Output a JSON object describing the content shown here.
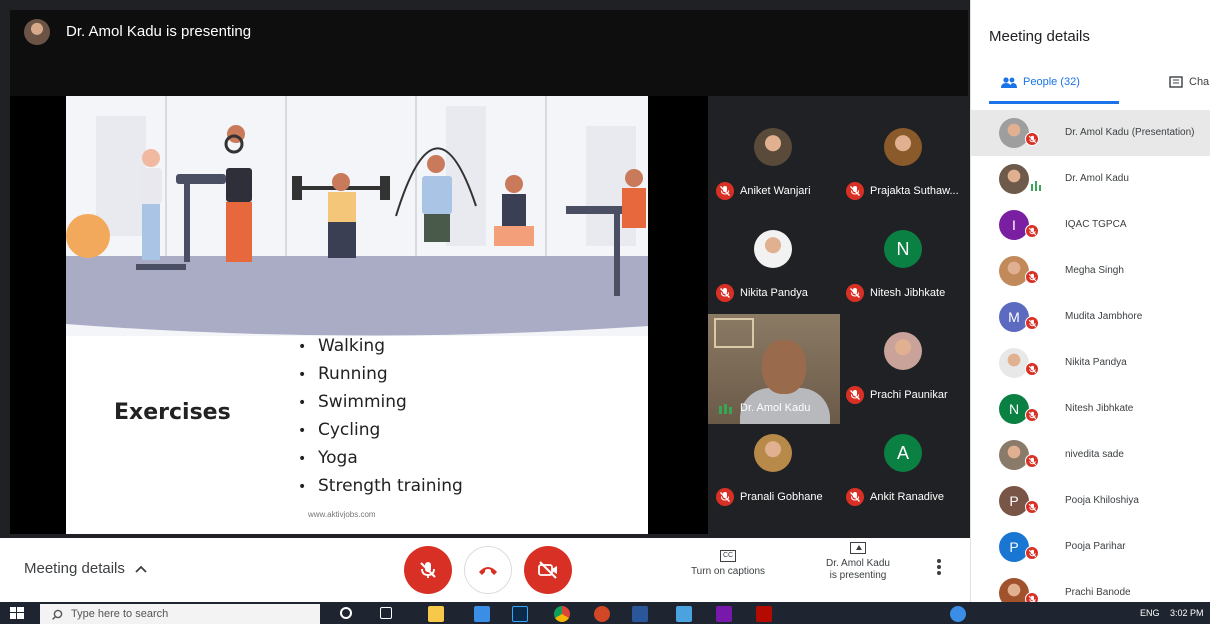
{
  "presenter_bar": {
    "text": "Dr. Amol Kadu is presenting"
  },
  "slide": {
    "title": "Exercises",
    "bullets": [
      "Walking",
      "Running",
      "Swimming",
      "Cycling",
      "Yoga",
      "Strength training"
    ],
    "watermark": "www.aktivjobs.com"
  },
  "tiles": [
    {
      "name": "Aniket Wanjari",
      "avatar_type": "photo",
      "avatar_color": "#5a4a3a"
    },
    {
      "name": "Prajakta Suthaw...",
      "avatar_type": "photo",
      "avatar_color": "#8a5a2a"
    },
    {
      "name": "Nikita Pandya",
      "avatar_type": "photo",
      "avatar_color": "#f2f2f2"
    },
    {
      "name": "Nitesh Jibhkate",
      "avatar_type": "letter",
      "letter": "N",
      "avatar_color": "#0b8043"
    },
    {
      "name": "Prachi Paunikar",
      "avatar_type": "photo",
      "avatar_color": "#c9a29a"
    },
    {
      "name": "Pranali Gobhane",
      "avatar_type": "photo",
      "avatar_color": "#b88a4a"
    },
    {
      "name": "Ankit Ranadive",
      "avatar_type": "letter",
      "letter": "A",
      "avatar_color": "#0b8043"
    }
  ],
  "video_tile": {
    "name": "Dr. Amol Kadu"
  },
  "controls": {
    "meeting_details": "Meeting details",
    "captions": "Turn on captions",
    "present_line1": "Dr. Amol Kadu",
    "present_line2": "is presenting",
    "cc_label": "CC"
  },
  "panel": {
    "title": "Meeting details",
    "tab_people": "People (32)",
    "tab_chat": "Cha",
    "people": [
      {
        "name": "Dr. Amol Kadu (Presentation)",
        "avatar_type": "photo",
        "avatar_color": "#9e9e9e",
        "muted": true,
        "highlight": true
      },
      {
        "name": "Dr. Amol Kadu",
        "avatar_type": "photo",
        "avatar_color": "#6d5a4a",
        "muted": false,
        "speaking": true
      },
      {
        "name": "IQAC TGPCA",
        "avatar_type": "letter",
        "letter": "I",
        "avatar_color": "#7b1fa2",
        "muted": true
      },
      {
        "name": "Megha Singh",
        "avatar_type": "photo",
        "avatar_color": "#c28a5a",
        "muted": true
      },
      {
        "name": "Mudita Jambhore",
        "avatar_type": "letter",
        "letter": "M",
        "avatar_color": "#5c6bc0",
        "muted": true
      },
      {
        "name": "Nikita Pandya",
        "avatar_type": "photo",
        "avatar_color": "#e8e8e8",
        "muted": true
      },
      {
        "name": "Nitesh Jibhkate",
        "avatar_type": "letter",
        "letter": "N",
        "avatar_color": "#0b8043",
        "muted": true
      },
      {
        "name": "nivedita sade",
        "avatar_type": "photo",
        "avatar_color": "#8a7a6a",
        "muted": true
      },
      {
        "name": "Pooja Khiloshiya",
        "avatar_type": "letter",
        "letter": "P",
        "avatar_color": "#795548",
        "muted": true
      },
      {
        "name": "Pooja Parihar",
        "avatar_type": "letter",
        "letter": "P",
        "avatar_color": "#1976d2",
        "muted": true
      },
      {
        "name": "Prachi Banode",
        "avatar_type": "photo",
        "avatar_color": "#a0522d",
        "muted": true
      }
    ]
  },
  "taskbar": {
    "search_placeholder": "Type here to search",
    "lang": "ENG",
    "time": "3:02 PM"
  }
}
